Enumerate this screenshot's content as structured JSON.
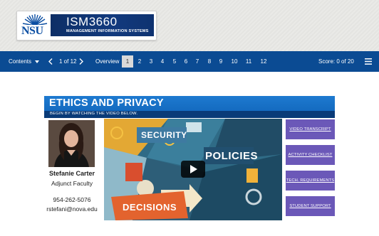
{
  "header": {
    "logo_text": "NSU",
    "course_code": "ISM3660",
    "course_name": "MANAGEMENT INFORMATION SYSTEMS"
  },
  "nav": {
    "contents_label": "Contents",
    "page_indicator": "1 of 12",
    "overview_label": "Overview",
    "pages": [
      "1",
      "2",
      "3",
      "4",
      "5",
      "6",
      "7",
      "8",
      "9",
      "10",
      "11",
      "12"
    ],
    "active_page": "1",
    "score": "Score: 0 of 20"
  },
  "module": {
    "title": "ETHICS AND PRIVACY",
    "subtitle": "BEGIN BY WATCHING THE VIDEO BELOW."
  },
  "instructor": {
    "name": "Stefanie Carter",
    "role": "Adjunct Faculty",
    "phone": "954-262-5076",
    "email": "rstefani@nova.edu"
  },
  "video": {
    "words": [
      "SECURITY",
      "POLICIES",
      "DECISIONS"
    ]
  },
  "side_buttons": [
    "VIDEO TRANSCRIPT",
    "ACTIVITY CHECKLIST",
    "TECH. REQUIREMENTS",
    "STUDENT SUPPORT"
  ],
  "colors": {
    "nav_bg": "#0b4b93",
    "header_blue": "#1e7ad0",
    "button_purple": "#6b58b8"
  }
}
